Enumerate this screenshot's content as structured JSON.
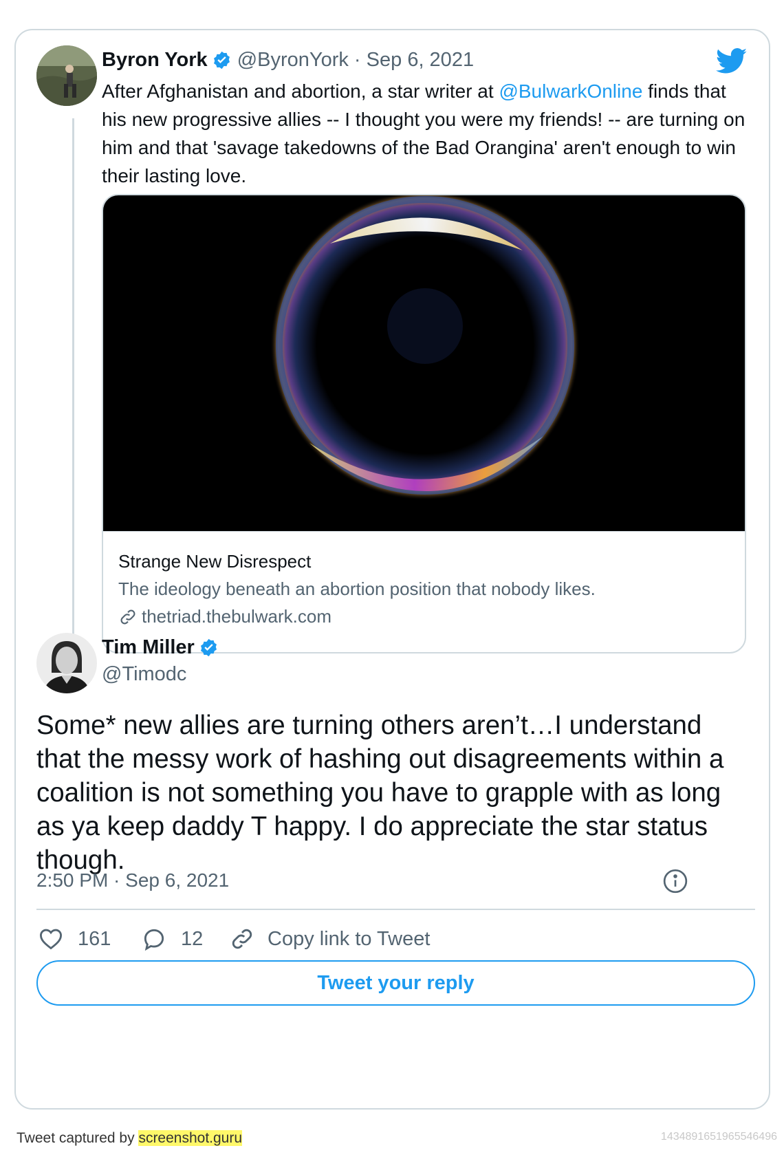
{
  "quoted_tweet": {
    "author_name": "Byron York",
    "handle": "@ByronYork",
    "separator": " · ",
    "date": "Sep 6, 2021",
    "text_before": "After Afghanistan and abortion, a star writer at ",
    "mention": "@BulwarkOnline",
    "text_after": " finds that his new progressive allies -- I thought you were my friends! -- are turning on him and that 'savage takedowns of the Bad Orangina' aren't enough to win their lasting love."
  },
  "link_card": {
    "title": "Strange New Disrespect",
    "description": "The ideology beneath an abortion position that nobody likes.",
    "domain": "thetriad.thebulwark.com"
  },
  "main_tweet": {
    "author_name": "Tim Miller",
    "handle": "@Timodc",
    "text": "Some* new allies are turning others aren’t…I understand that the messy work of hashing out disagreements within a coalition is not something you have to grapple with as long as ya keep daddy T happy. I do appreciate the star status though.",
    "time": "2:50 PM",
    "separator": " · ",
    "date": "Sep 6, 2021"
  },
  "actions": {
    "likes": "161",
    "replies": "12",
    "copy_link_label": "Copy link to Tweet"
  },
  "reply_button_label": "Tweet your reply",
  "footer": {
    "captured_by": "Tweet captured by ",
    "site": "screenshot.guru",
    "tweet_id": "1434891651965546496"
  },
  "colors": {
    "accent": "#1d9bf0",
    "text": "#0f1419",
    "muted": "#536471",
    "border": "#cfd9de",
    "highlight": "#fff86a"
  },
  "icons": [
    "verified-badge-icon",
    "twitter-bird-icon",
    "link-icon",
    "heart-icon",
    "reply-bubble-icon",
    "copy-link-icon",
    "info-icon"
  ]
}
